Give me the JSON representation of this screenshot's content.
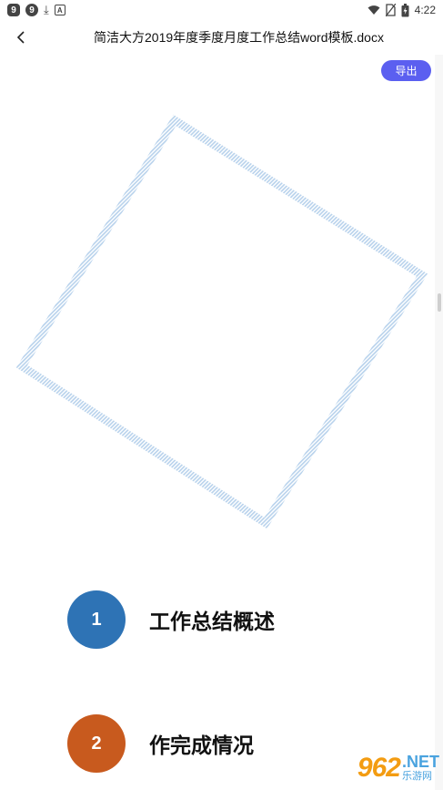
{
  "status_bar": {
    "app_icons": [
      {
        "glyph": "9",
        "name": "app-9-icon"
      },
      {
        "glyph": "9",
        "name": "app-9-round-icon"
      },
      {
        "glyph": "⤓",
        "name": "download-icon"
      },
      {
        "glyph": "A",
        "name": "a-notification-icon"
      }
    ],
    "time": "4:22"
  },
  "header": {
    "title": "简洁大方2019年度季度月度工作总结word模板.docx"
  },
  "toolbar": {
    "export_label": "导出"
  },
  "document": {
    "diamond_color": "#b8d2ec",
    "toc": [
      {
        "number": "1",
        "text": "工作总结概述",
        "color": "#2e73b5"
      },
      {
        "number": "2",
        "text": "作完成情况",
        "color": "#c85a1e"
      }
    ]
  },
  "watermark": {
    "main": "962",
    "net": ".NET",
    "sub": "乐游网"
  }
}
